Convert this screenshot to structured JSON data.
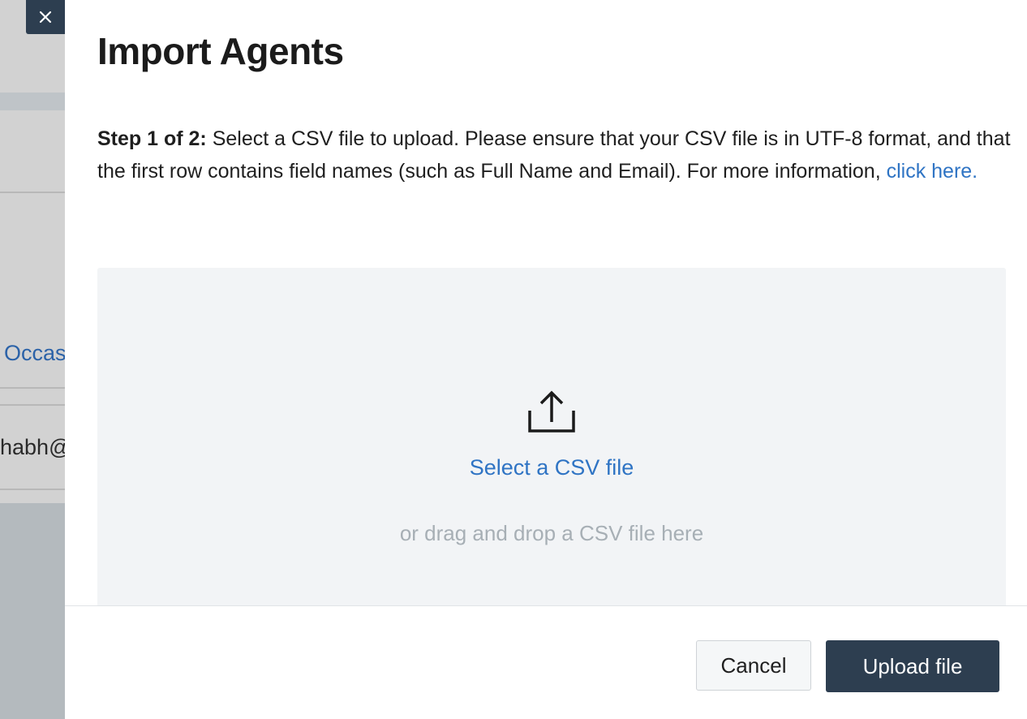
{
  "background_page": {
    "link_fragment": "Occas",
    "email_fragment": "habh@"
  },
  "modal": {
    "title": "Import Agents",
    "close_icon": "close-icon",
    "instructions": {
      "step_label": "Step 1 of 2:",
      "text": " Select a CSV file to upload. Please ensure that your CSV file is in UTF-8 format, and that the first row contains field names (such as Full Name and Email). For more information, ",
      "link": "click here."
    },
    "dropzone": {
      "icon": "upload-icon",
      "select_label": "Select a CSV file",
      "drag_hint": "or drag and drop a CSV file here"
    },
    "footer": {
      "cancel_label": "Cancel",
      "upload_label": "Upload file"
    }
  },
  "colors": {
    "primary": "#2d3e50",
    "link": "#2f74c4",
    "dropzone_bg": "#f2f4f6",
    "hint_text": "#a7afb5"
  }
}
